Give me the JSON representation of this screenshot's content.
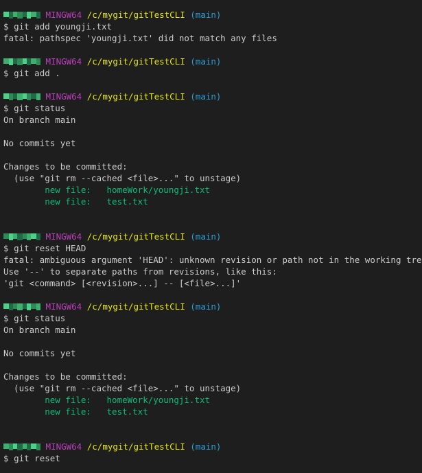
{
  "colors": {
    "background": "#1e1e1e",
    "text": "#cccccc",
    "host": "#bc3fbc",
    "path": "#e5e510",
    "branch": "#2c9fd6",
    "staged": "#0dbc79",
    "redacted_user": "#2e8b57"
  },
  "prompt": {
    "system": "MINGW64",
    "path": "/c/mygit/gitTestCLI",
    "branch": "(main)",
    "symbol": "$"
  },
  "blocks": [
    {
      "command": "git add youngji.txt",
      "output": [
        {
          "text": "fatal: pathspec 'youngji.txt' did not match any files",
          "style": "white"
        }
      ]
    },
    {
      "command": "git add .",
      "output": []
    },
    {
      "command": "git status",
      "output": [
        {
          "text": "On branch main",
          "style": "white"
        },
        {
          "text": "",
          "style": "white"
        },
        {
          "text": "No commits yet",
          "style": "white"
        },
        {
          "text": "",
          "style": "white"
        },
        {
          "text": "Changes to be committed:",
          "style": "white"
        },
        {
          "text": "  (use \"git rm --cached <file>...\" to unstage)",
          "style": "white"
        },
        {
          "text": "        new file:   homeWork/youngji.txt",
          "style": "green"
        },
        {
          "text": "        new file:   test.txt",
          "style": "green"
        },
        {
          "text": "",
          "style": "white"
        }
      ]
    },
    {
      "command": "git reset HEAD",
      "output": [
        {
          "text": "fatal: ambiguous argument 'HEAD': unknown revision or path not in the working tree.",
          "style": "white"
        },
        {
          "text": "Use '--' to separate paths from revisions, like this:",
          "style": "white"
        },
        {
          "text": "'git <command> [<revision>...] -- [<file>...]'",
          "style": "white"
        }
      ]
    },
    {
      "command": "git status",
      "output": [
        {
          "text": "On branch main",
          "style": "white"
        },
        {
          "text": "",
          "style": "white"
        },
        {
          "text": "No commits yet",
          "style": "white"
        },
        {
          "text": "",
          "style": "white"
        },
        {
          "text": "Changes to be committed:",
          "style": "white"
        },
        {
          "text": "  (use \"git rm --cached <file>...\" to unstage)",
          "style": "white"
        },
        {
          "text": "        new file:   homeWork/youngji.txt",
          "style": "green"
        },
        {
          "text": "        new file:   test.txt",
          "style": "green"
        },
        {
          "text": "",
          "style": "white"
        }
      ]
    },
    {
      "command": "git reset",
      "output": []
    }
  ]
}
